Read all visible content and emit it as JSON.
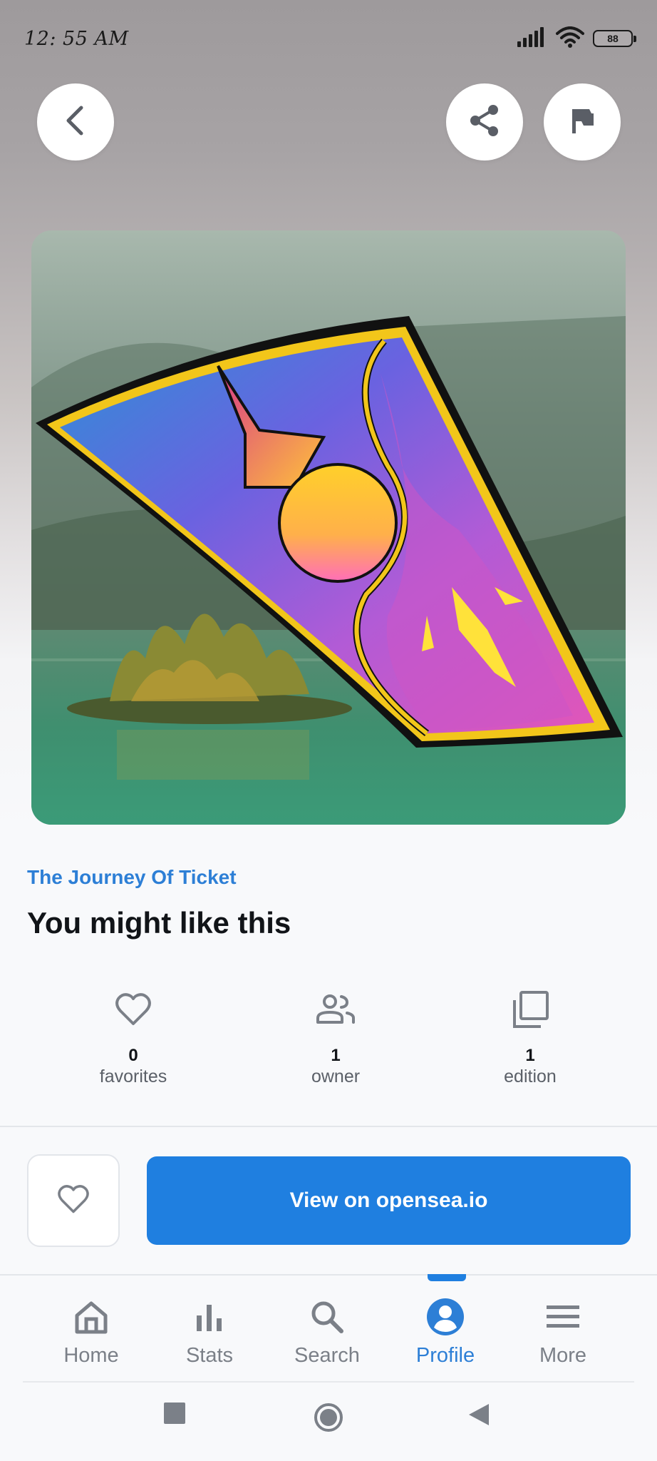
{
  "status_bar": {
    "time": "12: 55 AM",
    "battery": "88"
  },
  "header": {
    "back_icon": "chevron-left-icon",
    "share_icon": "share-icon",
    "report_icon": "flag-icon"
  },
  "item": {
    "collection": "The Journey Of Ticket",
    "title": "You might like this"
  },
  "stats": [
    {
      "icon": "heart-icon",
      "value": "0",
      "label": "favorites"
    },
    {
      "icon": "people-icon",
      "value": "1",
      "label": "owner"
    },
    {
      "icon": "copies-icon",
      "value": "1",
      "label": "edition"
    }
  ],
  "actions": {
    "favorite_icon": "heart-outline-icon",
    "cta_label": "View on opensea.io"
  },
  "bottom_nav": {
    "items": [
      {
        "label": "Home",
        "icon": "home-icon"
      },
      {
        "label": "Stats",
        "icon": "bar-chart-icon"
      },
      {
        "label": "Search",
        "icon": "search-icon"
      },
      {
        "label": "Profile",
        "icon": "account-circle-icon"
      },
      {
        "label": "More",
        "icon": "menu-icon"
      }
    ],
    "active_index": 3
  },
  "colors": {
    "accent": "#1f7fe0",
    "accent_text": "#2d7fd6",
    "muted_text": "#5b6068",
    "icon_gray": "#7b8088"
  }
}
